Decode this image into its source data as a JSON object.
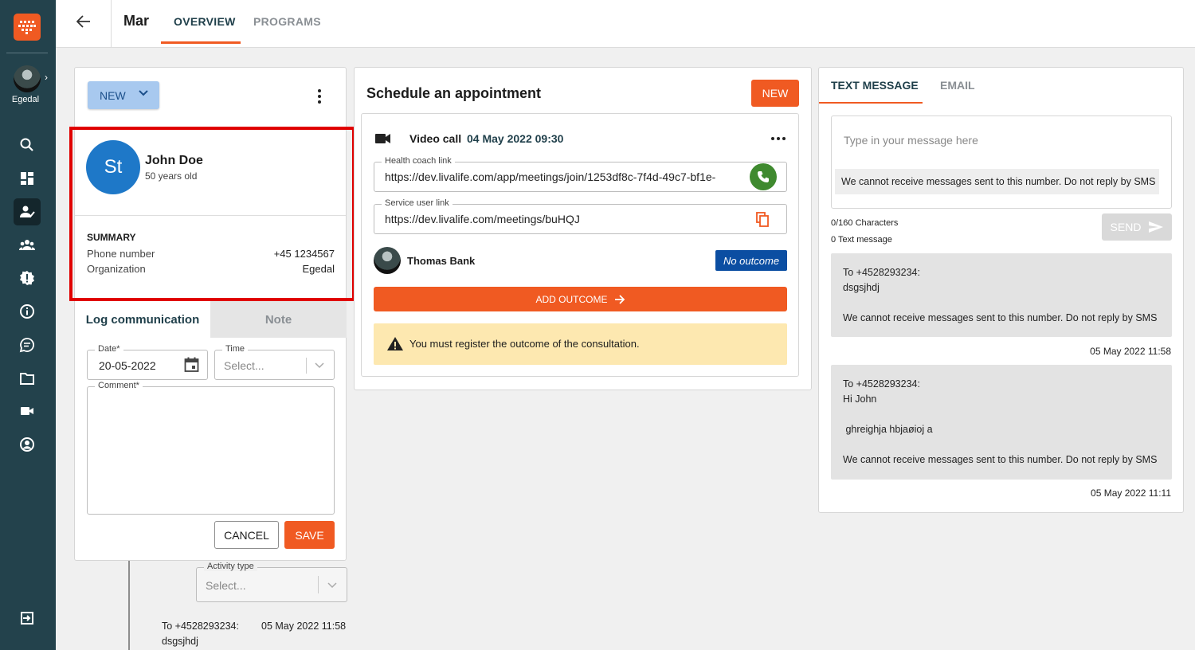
{
  "sidebar": {
    "avatar_label": "Egedal",
    "icons": [
      "search-icon",
      "dashboard-icon",
      "patient-check-icon",
      "group-icon",
      "alert-badge-icon",
      "info-icon",
      "chat-icon",
      "folder-icon",
      "video-icon",
      "account-icon",
      "logout-icon"
    ],
    "accent": "#f05a22",
    "bg": "#23424c"
  },
  "header": {
    "title": "Mar",
    "tabs": [
      {
        "label": "OVERVIEW",
        "active": true
      },
      {
        "label": "PROGRAMS",
        "active": false
      }
    ]
  },
  "patient_card": {
    "new_button": "NEW",
    "avatar_initials": "St",
    "name": "John Doe",
    "age": "50 years old",
    "summary_title": "SUMMARY",
    "phone_label": "Phone number",
    "phone_value": "+45 1234567",
    "org_label": "Organization",
    "org_value": "Egedal"
  },
  "log": {
    "tabs": [
      {
        "label": "Log communication",
        "active": true
      },
      {
        "label": "Note",
        "active": false
      }
    ],
    "date_label": "Date*",
    "date_value": "20-05-2022",
    "time_label": "Time",
    "time_placeholder": "Select...",
    "comment_label": "Comment*",
    "cancel_label": "CANCEL",
    "save_label": "SAVE"
  },
  "timeline": {
    "activity_label": "Activity type",
    "activity_placeholder": "Select...",
    "entry_to": "To +4528293234:",
    "entry_time": "05 May 2022 11:58",
    "entry_text": "dsgsjhdj"
  },
  "schedule": {
    "title": "Schedule an appointment",
    "new_label": "NEW",
    "call_type": "Video call",
    "call_datetime": "04 May 2022 09:30",
    "coach_link_label": "Health coach link",
    "coach_link": "https://dev.livalife.com/app/meetings/join/1253df8c-7f4d-49c7-bf1e-",
    "user_link_label": "Service user link",
    "user_link": "https://dev.livalife.com/meetings/buHQJ",
    "participant": "Thomas Bank",
    "outcome_badge": "No outcome",
    "add_outcome": "ADD OUTCOME",
    "warning": "You must register the outcome of the consultation."
  },
  "messaging": {
    "tabs": [
      {
        "label": "TEXT MESSAGE",
        "active": true
      },
      {
        "label": "EMAIL",
        "active": false
      }
    ],
    "placeholder": "Type in your message here",
    "notice": "We cannot receive messages sent to this number. Do not reply by SMS",
    "char_count": "0/160 Characters",
    "msg_count": "0 Text message",
    "send_label": "SEND",
    "messages": [
      {
        "to": "To +4528293234:",
        "lines": [
          "dsgsjhdj"
        ],
        "footer": "We cannot receive messages sent to this number. Do not reply by SMS",
        "time": "05 May 2022 11:58"
      },
      {
        "to": "To +4528293234:",
        "lines": [
          "Hi John",
          " ghreighja hbjaøioj a"
        ],
        "footer": "We cannot receive messages sent to this number. Do not reply by SMS",
        "time": "05 May 2022 11:11"
      }
    ]
  }
}
